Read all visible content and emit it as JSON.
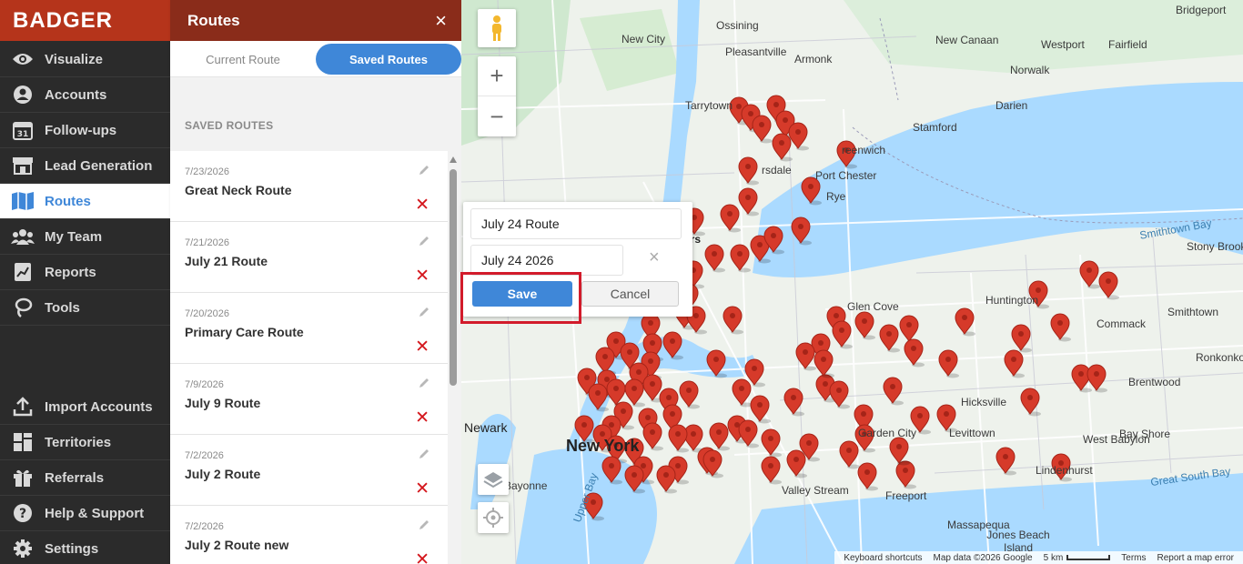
{
  "brand": {
    "logo_text": "BADGER",
    "logo_color": "#b5341b"
  },
  "nav": {
    "items": [
      {
        "label": "Visualize",
        "icon": "eye-icon"
      },
      {
        "label": "Accounts",
        "icon": "user-circle-icon"
      },
      {
        "label": "Follow-ups",
        "icon": "calendar-icon"
      },
      {
        "label": "Lead Generation",
        "icon": "storefront-icon"
      },
      {
        "label": "Routes",
        "icon": "map-icon",
        "active": true
      },
      {
        "label": "My Team",
        "icon": "team-icon"
      },
      {
        "label": "Reports",
        "icon": "report-icon"
      },
      {
        "label": "Tools",
        "icon": "lasso-icon"
      }
    ],
    "bottom_items": [
      {
        "label": "Import Accounts",
        "icon": "upload-icon"
      },
      {
        "label": "Territories",
        "icon": "territories-icon"
      },
      {
        "label": "Referrals",
        "icon": "gift-icon"
      },
      {
        "label": "Help & Support",
        "icon": "help-icon"
      },
      {
        "label": "Settings",
        "icon": "gear-icon"
      }
    ]
  },
  "panel": {
    "title": "Routes",
    "close_icon": "×",
    "tabs": {
      "current": "Current Route",
      "saved": "Saved Routes"
    },
    "section_label": "SAVED ROUTES",
    "routes": [
      {
        "date": "7/23/2026",
        "name": "Great Neck Route"
      },
      {
        "date": "7/21/2026",
        "name": "July 21 Route"
      },
      {
        "date": "7/20/2026",
        "name": "Primary Care Route"
      },
      {
        "date": "7/9/2026",
        "name": "July 9 Route"
      },
      {
        "date": "7/2/2026",
        "name": "July 2 Route"
      },
      {
        "date": "7/2/2026",
        "name": "July 2 Route new"
      }
    ],
    "delete_symbol": "✕"
  },
  "save_popup": {
    "name_value": "July 24 Route",
    "date_value": "July 24 2026",
    "clear_symbol": "×",
    "save_label": "Save",
    "cancel_label": "Cancel"
  },
  "map": {
    "zoom_in": "+",
    "zoom_out": "−",
    "place_labels": [
      "New City",
      "Ossining",
      "Pleasantville",
      "Armonk",
      "New Canaan",
      "Westport",
      "Fairfield",
      "Norwalk",
      "Bridgeport",
      "Tarrytown",
      "Darien",
      "Stamford",
      "Port Chester",
      "Rye",
      "Glen Cove",
      "Huntington",
      "Commack",
      "Hicksville",
      "Levittown",
      "Garden City",
      "Massapequa",
      "Lindenhurst",
      "West Babylon",
      "Bay Shore",
      "Brentwood",
      "Ronkonkoma",
      "Smithtown",
      "Stony Brook",
      "Freeport",
      "Valley Stream",
      "Jones Beach Island",
      "Newark",
      "Bayonne",
      "New York",
      "reenwich",
      "rsdale",
      "ers"
    ],
    "water_labels": [
      "Smithtown Bay",
      "Great South Bay",
      "Upper Bay"
    ],
    "attribution": {
      "keyboard": "Keyboard shortcuts",
      "map_data": "Map data ©2026 Google",
      "scale": "5 km",
      "terms": "Terms",
      "report": "Report a map error"
    },
    "marker_color": "#d63a2a"
  }
}
